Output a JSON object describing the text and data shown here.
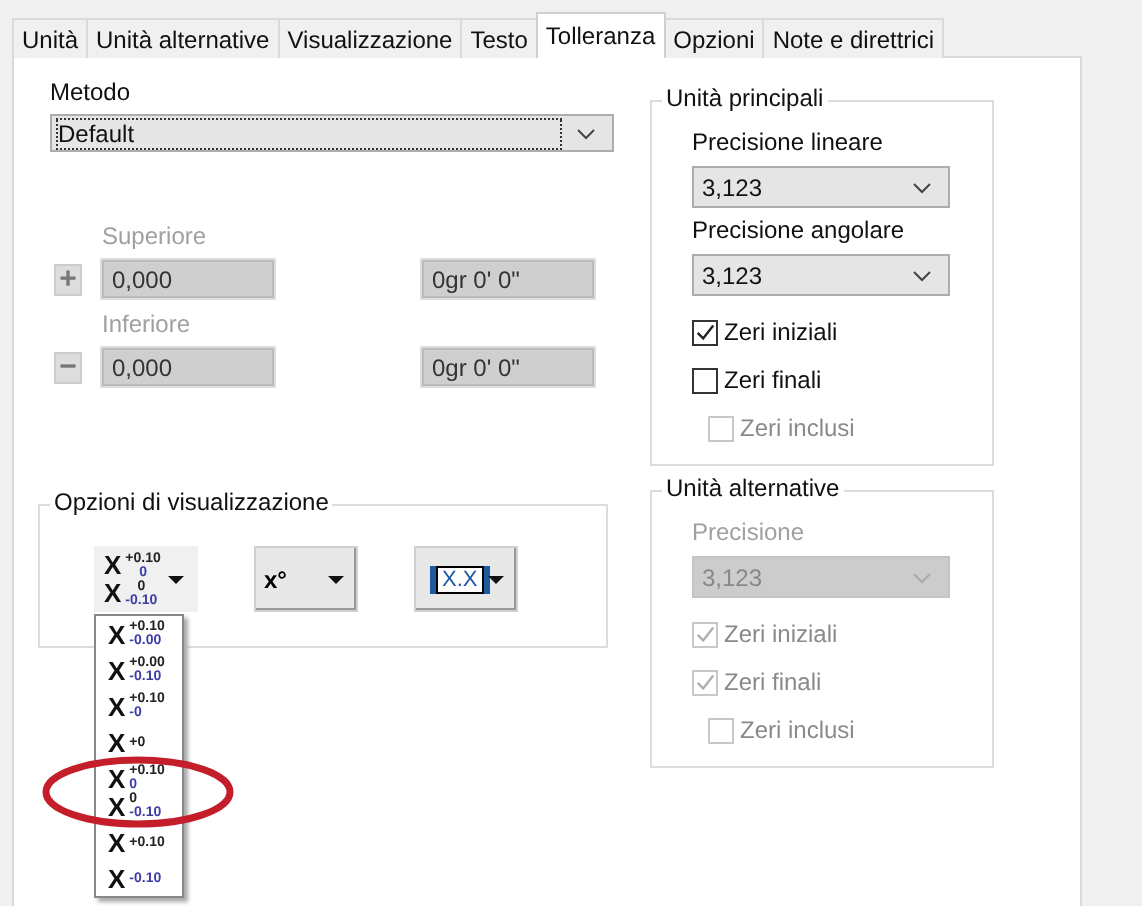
{
  "tabs": [
    {
      "label": "Unità",
      "selected": false
    },
    {
      "label": "Unità alternative",
      "selected": false
    },
    {
      "label": "Visualizzazione",
      "selected": false
    },
    {
      "label": "Testo",
      "selected": false
    },
    {
      "label": "Tolleranza",
      "selected": true
    },
    {
      "label": "Opzioni",
      "selected": false
    },
    {
      "label": "Note e direttrici",
      "selected": false
    }
  ],
  "method": {
    "label": "Metodo",
    "value": "Default"
  },
  "tolerance": {
    "disabled": true,
    "rows": [
      {
        "label": "Superiore",
        "sign": "+",
        "value": "0,000",
        "angle": "0gr 0' 0\""
      },
      {
        "label": "Inferiore",
        "sign": "−",
        "value": "0,000",
        "angle": "0gr 0' 0\""
      }
    ]
  },
  "display_options": {
    "title": "Opzioni di visualizzazione",
    "buttons": [
      {
        "kind": "format",
        "lines": [
          {
            "base": "X",
            "sup": "+0.10",
            "sub": "0"
          },
          {
            "base": "X",
            "sup": "0",
            "sub": "-0.10"
          }
        ]
      },
      {
        "kind": "text",
        "text": "x°"
      },
      {
        "kind": "box",
        "text": "X.X"
      }
    ],
    "dropdown": {
      "items": [
        {
          "lines": [
            {
              "base": "X",
              "sup": "+0.10",
              "sub": "-0.00"
            }
          ]
        },
        {
          "lines": [
            {
              "base": "X",
              "sup": "+0.00",
              "sub": "-0.10"
            }
          ]
        },
        {
          "lines": [
            {
              "base": "X",
              "sup": "+0.10",
              "sub": "-0"
            }
          ]
        },
        {
          "lines": [
            {
              "base": "X",
              "sup": "+0"
            }
          ]
        },
        {
          "lines": [
            {
              "base": "X",
              "sup": "+0.10",
              "sub": "0"
            },
            {
              "base": "X",
              "sup": "0",
              "sub": "-0.10"
            }
          ]
        },
        {
          "lines": [
            {
              "base": "X",
              "sup": "+0.10"
            }
          ]
        },
        {
          "lines": [
            {
              "base": "X",
              "sub": "-0.10"
            }
          ]
        }
      ]
    }
  },
  "primary_units": {
    "title": "Unità principali",
    "disabled": false,
    "fields": [
      {
        "label": "Precisione lineare",
        "value": "3,123"
      },
      {
        "label": "Precisione angolare",
        "value": "3,123"
      }
    ],
    "checkboxes": [
      {
        "label": "Zeri iniziali",
        "checked": true,
        "disabled": false
      },
      {
        "label": "Zeri finali",
        "checked": false,
        "disabled": false,
        "children": [
          {
            "label": "Zeri inclusi",
            "checked": false,
            "disabled": true
          }
        ]
      }
    ]
  },
  "alternate_units": {
    "title": "Unità alternative",
    "disabled": true,
    "fields": [
      {
        "label": "Precisione",
        "value": "3,123"
      }
    ],
    "checkboxes": [
      {
        "label": "Zeri iniziali",
        "checked": true,
        "disabled": true
      },
      {
        "label": "Zeri finali",
        "checked": true,
        "disabled": true,
        "children": [
          {
            "label": "Zeri inclusi",
            "checked": false,
            "disabled": true
          }
        ]
      }
    ]
  }
}
